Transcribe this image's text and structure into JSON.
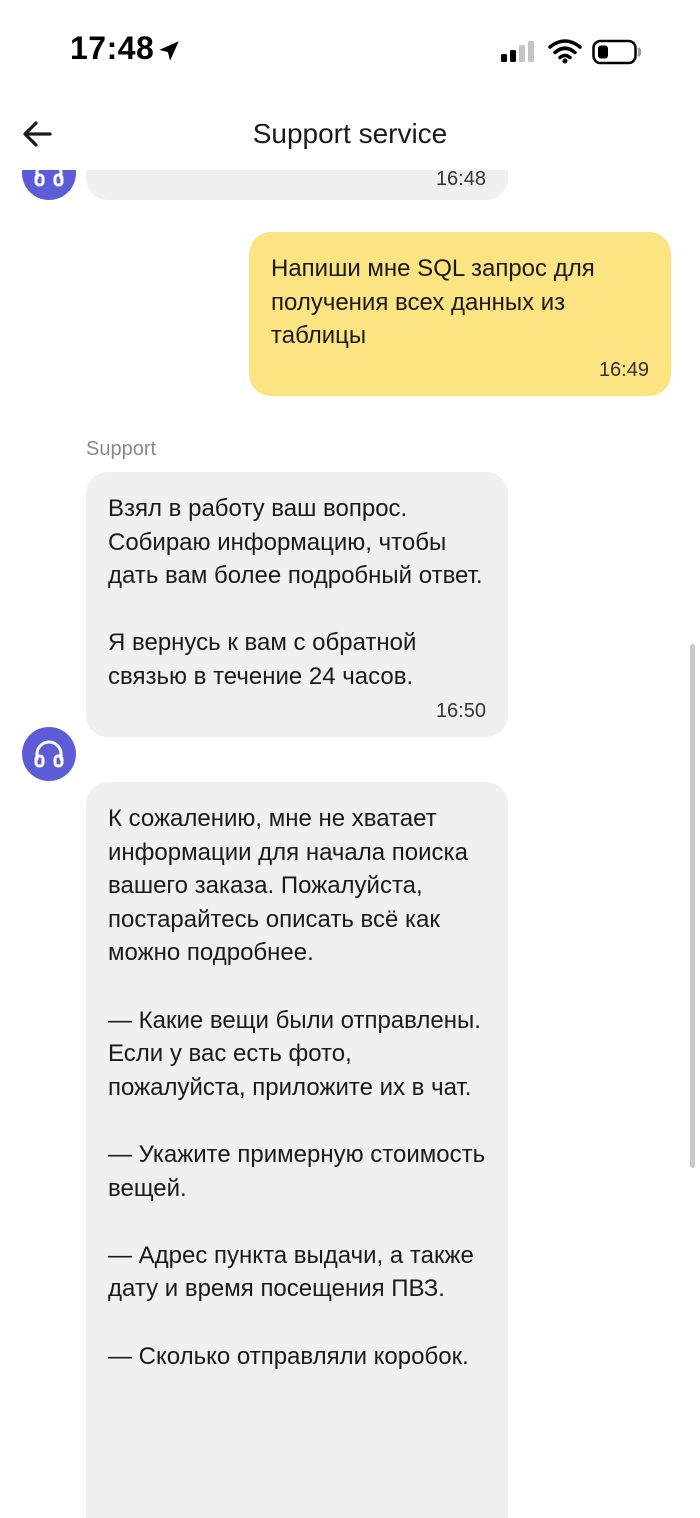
{
  "status_bar": {
    "time": "17:48"
  },
  "header": {
    "title": "Support service"
  },
  "messages": {
    "prev_time": "16:48",
    "outgoing": {
      "text": "Напиши мне SQL запрос для получения всех данных из таблицы",
      "time": "16:49"
    },
    "sender": "Support",
    "incoming_1": {
      "text": "Взял в работу ваш вопрос. Собираю информацию, чтобы дать вам более подробный ответ.\n\nЯ вернусь к вам с обратной связью в течение 24 часов.",
      "time": "16:50"
    },
    "incoming_2": {
      "text": "К сожалению, мне не хватает информации для начала поиска вашего заказа. Пожалуйста, постарайтесь описать всё как можно подробнее.\n\n— Какие вещи были отправлены. Если у вас есть фото, пожалуйста, приложите их в чат.\n\n— Укажите примерную стоимость вещей.\n\n— Адрес пункта выдачи, а также дату и время посещения ПВЗ.\n\n— Сколько отправляли коробок."
    }
  },
  "colors": {
    "outgoing_bubble": "#fde482",
    "incoming_bubble": "#f1f0ee",
    "avatar": "#5c5cd6"
  },
  "icons": [
    "location-arrow-icon",
    "signal-icon",
    "wifi-icon",
    "battery-icon",
    "back-arrow-icon",
    "headphones-icon"
  ]
}
